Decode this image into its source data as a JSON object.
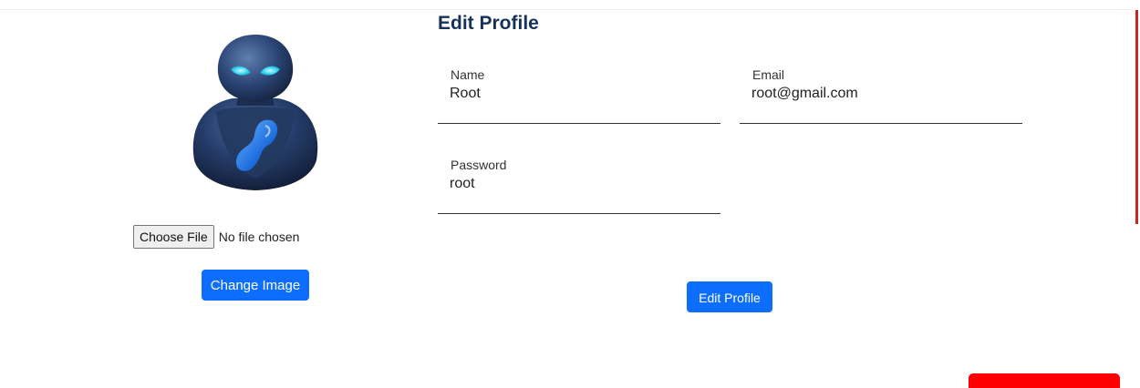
{
  "profile_image": {
    "icon": "robot-avatar-icon",
    "file_input": {
      "button_label": "Choose File",
      "status": "No file chosen"
    },
    "change_image_label": "Change Image"
  },
  "form": {
    "title": "Edit Profile",
    "name": {
      "label": "Name",
      "value": "Root"
    },
    "email": {
      "label": "Email",
      "value": "root@gmail.com"
    },
    "password": {
      "label": "Password",
      "value": "root"
    },
    "submit_label": "Edit Profile"
  },
  "colors": {
    "primary": "#0d6efd",
    "title": "#16325c",
    "accent_red": "#ff0000"
  }
}
